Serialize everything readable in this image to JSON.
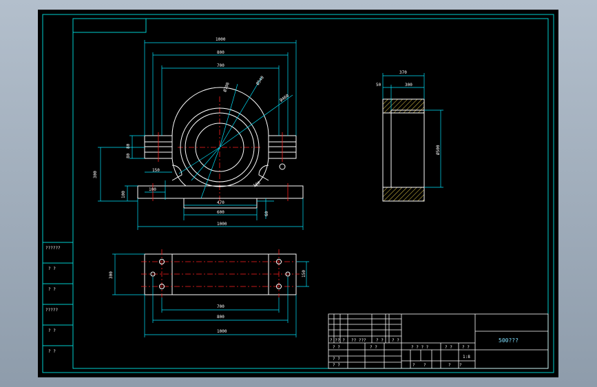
{
  "colors": {
    "background_outer": "#9aa8b6",
    "canvas": "#000000",
    "frame": "#00d0d0",
    "geometry": "#ffffff",
    "dimension": "#00e5ff",
    "centerline": "#ff2020",
    "hatch": "#c8b040",
    "title_text": "#7fe0ff"
  },
  "left_table_labels": [
    "??????",
    "? ?",
    "? ?",
    "?????",
    "? ?",
    "? ?"
  ],
  "title_block": {
    "row1": [
      "? ?",
      "? ?",
      "?? ???",
      "? ?",
      "? ?"
    ],
    "row2": [
      "? ?",
      "? ?"
    ],
    "row3": [
      "? ?",
      "? ?"
    ],
    "mid_header": [
      "? ? ? ?",
      "? ?",
      "? ?"
    ],
    "mid_value": "1:8",
    "mid_bottom": [
      "?",
      "?",
      "?",
      "?"
    ],
    "drawing_title": "500???"
  },
  "front_view_dims": {
    "top1": "1000",
    "top2": "800",
    "top3": "700",
    "left_height": "300",
    "left_small1": "80",
    "left_small2": "80",
    "left_small3": "150",
    "bottom_small": "100",
    "base_inner": "470",
    "base_mid": "600",
    "base_total": "1000",
    "base_right": "60",
    "diam1": "Ø700",
    "diam2": "Ø540",
    "diam3": "Ø460",
    "lug": "100"
  },
  "side_view_dims": {
    "top_total": "370",
    "top_left": "50",
    "top_right": "300",
    "right_dia": "Ø500"
  },
  "top_view_dims": {
    "left_height": "300",
    "right_height": "150",
    "inner": "700",
    "mid": "800",
    "total": "1000"
  }
}
